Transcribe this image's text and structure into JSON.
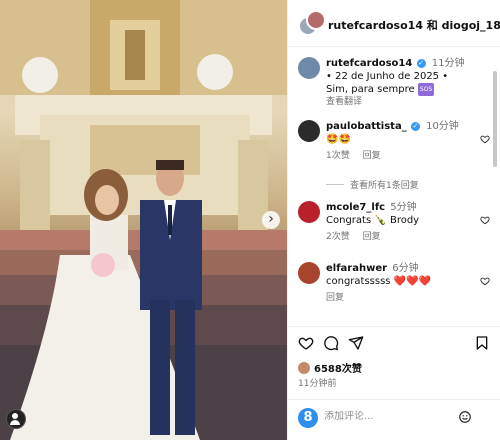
{
  "header": {
    "title": "rutefcardoso14 和 diogoj_18"
  },
  "caption": {
    "username": "rutefcardoso14",
    "time": "11分钟",
    "text_line1": "• 22 de Junho de 2025 •",
    "text_line2": "Sim, para sempre",
    "text_emoji": "SOS",
    "translate": "查看翻译"
  },
  "comments": [
    {
      "username": "paulobattista_",
      "time": "10分钟",
      "text": "🤩🤩",
      "likes": "1次赞",
      "reply": "回复",
      "avatar_color": "#2b2b2b"
    },
    {
      "view_replies": "查看所有1条回复"
    },
    {
      "username": "mcole7_lfc",
      "time": "5分钟",
      "text": "Congrats 🍾 Brody",
      "likes": "2次赞",
      "reply": "回复",
      "avatar_color": "#b8202a"
    },
    {
      "username": "elfarahwer",
      "time": "6分钟",
      "text": "congratsssss ❤️❤️❤️",
      "reply": "回复",
      "avatar_color": "#a8442e"
    }
  ],
  "actions": {
    "likes": "6588次赞",
    "posted": "11分钟前"
  },
  "add_comment": {
    "placeholder": "添加评论..."
  },
  "colors": {
    "verified": "#3897f0",
    "heart_red": "#e0245e",
    "border": "#efefef",
    "meta_gray": "#737373"
  }
}
